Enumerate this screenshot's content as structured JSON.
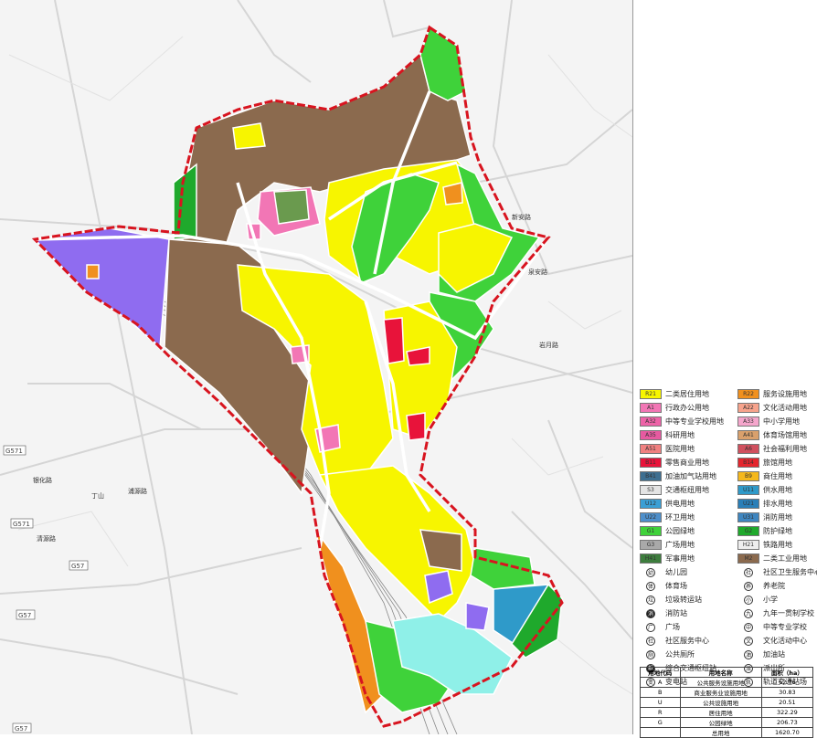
{
  "legend": {
    "landuse": [
      {
        "code": "R21",
        "name": "二类居住用地",
        "color": "#f7f500"
      },
      {
        "code": "R22",
        "name": "服务设施用地",
        "color": "#f0901e"
      },
      {
        "code": "A1",
        "name": "行政办公用地",
        "color": "#f276b5"
      },
      {
        "code": "A22",
        "name": "文化活动用地",
        "color": "#f7a38c"
      },
      {
        "code": "A32",
        "name": "中等专业学校用地",
        "color": "#ee63a8"
      },
      {
        "code": "A33",
        "name": "中小学用地",
        "color": "#f5a6cc"
      },
      {
        "code": "A35",
        "name": "科研用地",
        "color": "#e65aa0"
      },
      {
        "code": "A41",
        "name": "体育场馆用地",
        "color": "#d9a06c"
      },
      {
        "code": "A51",
        "name": "医院用地",
        "color": "#f08080"
      },
      {
        "code": "A6",
        "name": "社会福利用地",
        "color": "#d0505e"
      },
      {
        "code": "B11",
        "name": "零售商业用地",
        "color": "#e8133a"
      },
      {
        "code": "B14",
        "name": "旅馆用地",
        "color": "#e4262e"
      },
      {
        "code": "B41",
        "name": "加油加气站用地",
        "color": "#3d6f91"
      },
      {
        "code": "B9",
        "name": "商住用地",
        "color": "#f5b81c"
      },
      {
        "code": "S3",
        "name": "交通枢纽用地",
        "color": "#e4e4e4"
      },
      {
        "code": "U11",
        "name": "供水用地",
        "color": "#2f9ac9"
      },
      {
        "code": "U12",
        "name": "供电用地",
        "color": "#3a9fd5"
      },
      {
        "code": "U21",
        "name": "排水用地",
        "color": "#2a7fb8"
      },
      {
        "code": "U22",
        "name": "环卫用地",
        "color": "#4d8fcb"
      },
      {
        "code": "U31",
        "name": "消防用地",
        "color": "#3f86c0"
      },
      {
        "code": "G1",
        "name": "公园绿地",
        "color": "#3fd23a"
      },
      {
        "code": "G2",
        "name": "防护绿地",
        "color": "#1fa92c"
      },
      {
        "code": "G3",
        "name": "广场用地",
        "color": "#a9a9a9"
      },
      {
        "code": "H21",
        "name": "铁路用地",
        "color": "#eeeeee"
      },
      {
        "code": "H41",
        "name": "军事用地",
        "color": "#3d7d3d"
      },
      {
        "code": "M2",
        "name": "二类工业用地",
        "color": "#8b6a4e"
      }
    ],
    "facilities": [
      {
        "symbol": "幼",
        "name": "幼儿园",
        "filled": false
      },
      {
        "symbol": "社",
        "name": "社区卫生服务中心",
        "filled": false
      },
      {
        "symbol": "体",
        "name": "体育场",
        "filled": false
      },
      {
        "symbol": "养",
        "name": "养老院",
        "filled": false
      },
      {
        "symbol": "垃",
        "name": "垃圾转运站",
        "filled": false
      },
      {
        "symbol": "小",
        "name": "小学",
        "filled": false
      },
      {
        "symbol": "消",
        "name": "消防站",
        "filled": true
      },
      {
        "symbol": "九",
        "name": "九年一贯制学校",
        "filled": false
      },
      {
        "symbol": "广",
        "name": "广场",
        "filled": false
      },
      {
        "symbol": "中",
        "name": "中等专业学校",
        "filled": false
      },
      {
        "symbol": "社",
        "name": "社区服务中心",
        "filled": false
      },
      {
        "symbol": "文",
        "name": "文化活动中心",
        "filled": false
      },
      {
        "symbol": "厕",
        "name": "公共厕所",
        "filled": false
      },
      {
        "symbol": "油",
        "name": "加油站",
        "filled": false
      },
      {
        "symbol": "枢",
        "name": "综合交通枢纽站",
        "filled": true
      },
      {
        "symbol": "派",
        "name": "派出所",
        "filled": false
      },
      {
        "symbol": "变",
        "name": "变电站",
        "filled": false
      },
      {
        "symbol": "轨",
        "name": "轨道交通站场",
        "filled": false
      }
    ]
  },
  "area_table": {
    "headers": [
      "用地代码",
      "用地名称",
      "面积（ha）"
    ],
    "rows": [
      [
        "A",
        "公共服务设施用地",
        "62.76"
      ],
      [
        "B",
        "商业服务业设施用地",
        "30.83"
      ],
      [
        "U",
        "公共设施用地",
        "20.51"
      ],
      [
        "R",
        "居住用地",
        "322.29"
      ],
      [
        "G",
        "公园绿地",
        "206.73"
      ],
      [
        "",
        "总用地",
        "1620.70"
      ]
    ]
  },
  "map_labels": {
    "roads": [
      "G571",
      "G571",
      "G57",
      "G57",
      "G57"
    ],
    "places": [
      "丁山",
      "银化路",
      "清源路",
      "岩月路",
      "浦源路",
      "泉安路",
      "新安路"
    ]
  },
  "colors": {
    "boundary": "#d8141f",
    "residential": "#f7f500",
    "industrial": "#8b6a4e",
    "park": "#3fd23a",
    "protective": "#1fa92c",
    "purple": "#8f6cf0",
    "road": "#ffffff",
    "background": "#f4f4f4"
  }
}
